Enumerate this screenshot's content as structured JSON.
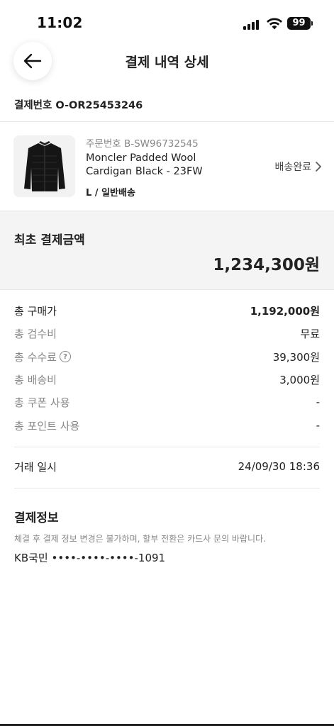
{
  "status": {
    "time": "11:02",
    "battery": "99"
  },
  "nav": {
    "title": "결제 내역 상세"
  },
  "order": {
    "number_label": "결제번호 O-OR25453246"
  },
  "product": {
    "code": "주문번호 B-SW96732545",
    "name_line1": "Moncler Padded Wool",
    "name_line2": "Cardigan Black - 23FW",
    "option": "L / 일반배송",
    "status": "배송완료"
  },
  "total": {
    "label": "최초 결제금액",
    "amount": "1,234,300원"
  },
  "breakdown": [
    {
      "label": "총 구매가",
      "value": "1,192,000원"
    },
    {
      "label": "총 검수비",
      "value": "무료"
    },
    {
      "label": "총 수수료",
      "value": "39,300원"
    },
    {
      "label": "총 배송비",
      "value": "3,000원"
    },
    {
      "label": "총 쿠폰 사용",
      "value": "-"
    },
    {
      "label": "총 포인트 사용",
      "value": "-"
    }
  ],
  "transaction": {
    "label": "거래 일시",
    "value": "24/09/30 18:36"
  },
  "payment": {
    "title": "결제정보",
    "note": "체결 후 결제 정보 변경은 불가하며, 할부 전환은 카드사 문의 바랍니다.",
    "card": "KB국민 ••••-••••-••••-1091"
  },
  "icons": {
    "help": "?"
  }
}
